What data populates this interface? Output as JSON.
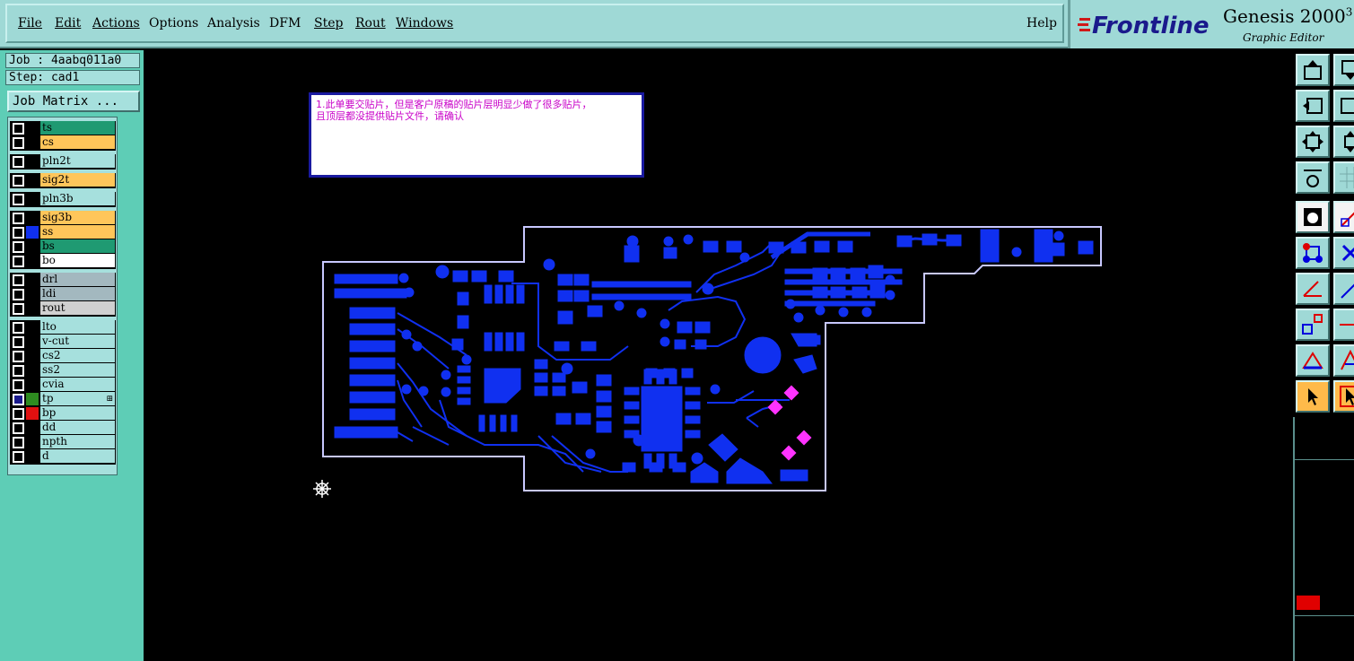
{
  "menu": [
    {
      "label": "File",
      "underline": "F"
    },
    {
      "label": "Edit",
      "underline": "E"
    },
    {
      "label": "Actions",
      "underline": "A"
    },
    {
      "label": "Options",
      "underline": ""
    },
    {
      "label": "Analysis",
      "underline": ""
    },
    {
      "label": "DFM",
      "underline": ""
    },
    {
      "label": "Step",
      "underline": "S"
    },
    {
      "label": "Rout",
      "underline": "R"
    },
    {
      "label": "Windows",
      "underline": "W"
    }
  ],
  "help_label": "Help",
  "brand": {
    "logo": "Frontline",
    "title": "Genesis 2000",
    "title_suffix": "3",
    "subtitle": "Graphic Editor"
  },
  "job": {
    "job_line": "Job : 4aabq011a0",
    "step_line": "Step: cad1",
    "matrix_button": "Job Matrix ..."
  },
  "layers": [
    {
      "name": "ts",
      "color": "green"
    },
    {
      "name": "cs",
      "color": "orange"
    },
    {
      "name": "pln2t",
      "color": "cyan"
    },
    {
      "name": "sig2t",
      "color": "orange"
    },
    {
      "name": "pln3b",
      "color": "cyan"
    },
    {
      "name": "sig3b",
      "color": "orange"
    },
    {
      "name": "ss",
      "color": "orange"
    },
    {
      "name": "bs",
      "color": "green"
    },
    {
      "name": "bo",
      "color": "white"
    },
    {
      "name": "drl",
      "color": "gray"
    },
    {
      "name": "ldi",
      "color": "gray"
    },
    {
      "name": "rout",
      "color": "lightgray"
    },
    {
      "name": "lto",
      "color": "cyan"
    },
    {
      "name": "v-cut",
      "color": "cyan"
    },
    {
      "name": "cs2",
      "color": "cyan"
    },
    {
      "name": "ss2",
      "color": "cyan"
    },
    {
      "name": "cvia",
      "color": "cyan"
    },
    {
      "name": "tp",
      "color": "cyan"
    },
    {
      "name": "bp",
      "color": "cyan"
    },
    {
      "name": "dd",
      "color": "cyan"
    },
    {
      "name": "npth",
      "color": "cyan"
    },
    {
      "name": "d",
      "color": "cyan"
    }
  ],
  "note": {
    "line1": "1.此单要交贴片，但是客户原稿的贴片层明显少做了很多贴片，",
    "line2": "且顶层都没提供贴片文件，请确认"
  },
  "colors": {
    "panel": "#9fd9d6",
    "left_panel": "#5ecdb6",
    "copper": "#1030f0",
    "smd_pad": "#ff33ff",
    "outline": "#c8c8ff",
    "accent_orange": "#ffba4a"
  },
  "toolbar_icons": [
    "layer-up-icon",
    "layer-down-icon",
    "fit-icon",
    "zoom-icon",
    "snap-icon",
    "grid-icon",
    "select-pad-icon",
    "line-icon",
    "connect-icon",
    "cross-icon",
    "angle-icon",
    "arc-icon",
    "node-icon",
    "measure-icon",
    "triangle-icon",
    "pointer-icon",
    "pointer-alt-icon"
  ]
}
